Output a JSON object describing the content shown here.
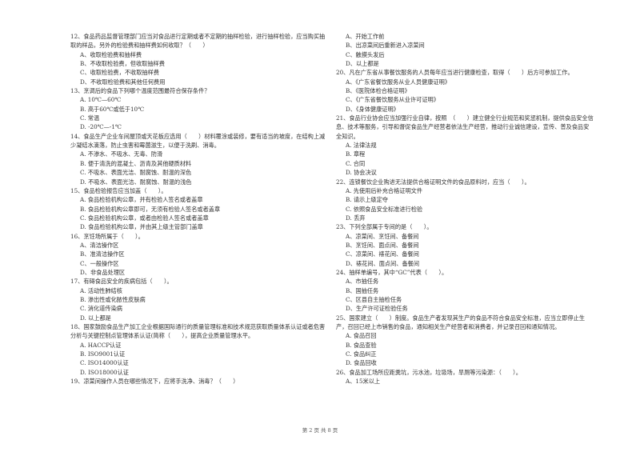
{
  "left_column": [
    {
      "id": "q12-end",
      "question": "12、食品药品监督管理部门应当对食品进行定期或者不定期的抽样检验，进行抽样检验，应当购买抽取的样品，另外的检验费和抽样费如何收取？（　　）",
      "options": [
        "A、收取检验费和抽样费",
        "B、不收取检验费，但收取抽样费",
        "C、收取检验费，不收取抽样费",
        "D、不收取检验费和其他任何费用"
      ]
    },
    {
      "id": "q13",
      "question": "13、烹调后的食品下列哪个温度范围最符合保存条件？",
      "options": [
        "A. 10℃—60℃",
        "B. 高于60℃或低于10℃",
        "C. 常温",
        "D. -20℃—-1℃"
      ]
    },
    {
      "id": "q14",
      "question": "14、食品生产企业车间屋顶或天花板应选用（　　）材料覆涂或装修，要有适当的坡度，在结构上减少凝结水滴落，防止虫害和霉菌滋生，以便于洗刷、消毒。",
      "options": [
        "A. 不渗水、不吸水、无毒、防滑",
        "B. 便于清洗的混凝土、沥青及其他硬质材料",
        "C. 不吸水、表面光洁、耐腐蚀、耐温的深色",
        "D. 不吸水、表面光洁、耐腐蚀、耐温的浅色"
      ]
    },
    {
      "id": "q15",
      "question": "15、食品检验报告应当加盖（　　）。",
      "options": [
        "A. 食品检验机构公章，并有检验人签名或者盖章",
        "B. 食品检验机构公章即可，无须有检验人签名或者盖章",
        "C. 食品检验机构公章，或者由检验人签名或者盖章",
        "D. 食品检验机构公章，并由其上级主管部门盖章"
      ]
    },
    {
      "id": "q16",
      "question": "16、烹饪场所属于（　　）。",
      "options": [
        "A、清洁操作区",
        "B、准清洁操作区",
        "C、一般操作区",
        "D、非食品处理区"
      ]
    },
    {
      "id": "q17",
      "question": "17、有碍食品安全的疾病包括（　　）。",
      "options": [
        "A. 活动性肺结核",
        "B. 渗出性或化脓性皮肤病",
        "C. 消化道传染病",
        "D. 以上都是"
      ]
    },
    {
      "id": "q18",
      "question": "18、国家鼓励食品生产加工企业根据国际通行的质量管理标准和技术规范获取质量体系认证或者危害分析与关键控制点管理体系认证(简称（　　），提高企业质量管理水平。",
      "options": [
        "A. HACCP认证",
        "B. ISO9001认证",
        "C. ISO14000认证",
        "D. ISO18000认证"
      ]
    },
    {
      "id": "q19",
      "question": "19、凉菜间操作人员在哪些情况下，应将手洗净、消毒？（　　）",
      "options": []
    }
  ],
  "right_column": [
    {
      "id": "q19-cont",
      "question": "",
      "options": [
        "A、开始工作前",
        "B、出凉菜间后重新进入凉菜间",
        "C、触摸头发后",
        "D、以上都是"
      ]
    },
    {
      "id": "q20",
      "question": "20、凡在广东省从事餐饮服务的人员每年应当进行健康检查，取得（　　）后方可参加工作。",
      "options": [
        "A、《广东省餐饮服务从业人员健康证明》",
        "B、《医院体检合格证明》",
        "C、《广东省餐饮服务从业许可证明》",
        "D、《身体健康证明》"
      ]
    },
    {
      "id": "q21",
      "question": "21、食品行业协会应当加强行业自律，按照　（　　）建立健全行业规范和奖惩机制，提供食品安全信息、技术等服务，引导和督促食品生产经营者依法生产经营，推动行业诚信建设，宣传、普及食品安全知识。",
      "options": [
        "A. 法律法规",
        "B. 章程",
        "C. 合同",
        "D. 协会决议"
      ]
    },
    {
      "id": "q22",
      "question": "22、连锁餐饮企业购进无法提供合格证明文件的食品原料时，应当（　　）。",
      "options": [
        "A. 先使用后补充合格证明文件",
        "B. 请示上级定夺",
        "C. 依照食品安全标准进行检验",
        "D. 丢弃"
      ]
    },
    {
      "id": "q23",
      "question": "23、下列全部属于专间的是（　　）。",
      "options": [
        "A、凉菜间、烹饪间、备餐间",
        "B、烹饪间、面点间、备餐间",
        "C、凉菜间、裱花间、备餐间",
        "D、裱花间、面点间、备餐间"
      ]
    },
    {
      "id": "q24",
      "question": "24、抽样单编号，其中“GC”代表（　　）。",
      "options": [
        "A、市抽任务",
        "B、国抽任务",
        "C、区县自主抽检任务",
        "D、生产许可证检验任务"
      ]
    },
    {
      "id": "q25",
      "question": "25、国家建立（　　）制度。食品生产者发现其生产的食品不符合食品安全标准，应当立即停止生产，召回已经上市销售的食品，通知相关生产经营者和消费者，并记录召回和通知情况。",
      "options": [
        "A. 食品召回",
        "B. 食品查验",
        "C. 食品纠正",
        "D. 食品回收"
      ]
    },
    {
      "id": "q26",
      "question": "26、食品加工场所应距粪坑，污水池，垃圾场，旱厕等污染源：（　　）。",
      "options": [
        "A、15米以上"
      ]
    }
  ],
  "footer": {
    "page_label": "第 2 页 共 8 页"
  }
}
